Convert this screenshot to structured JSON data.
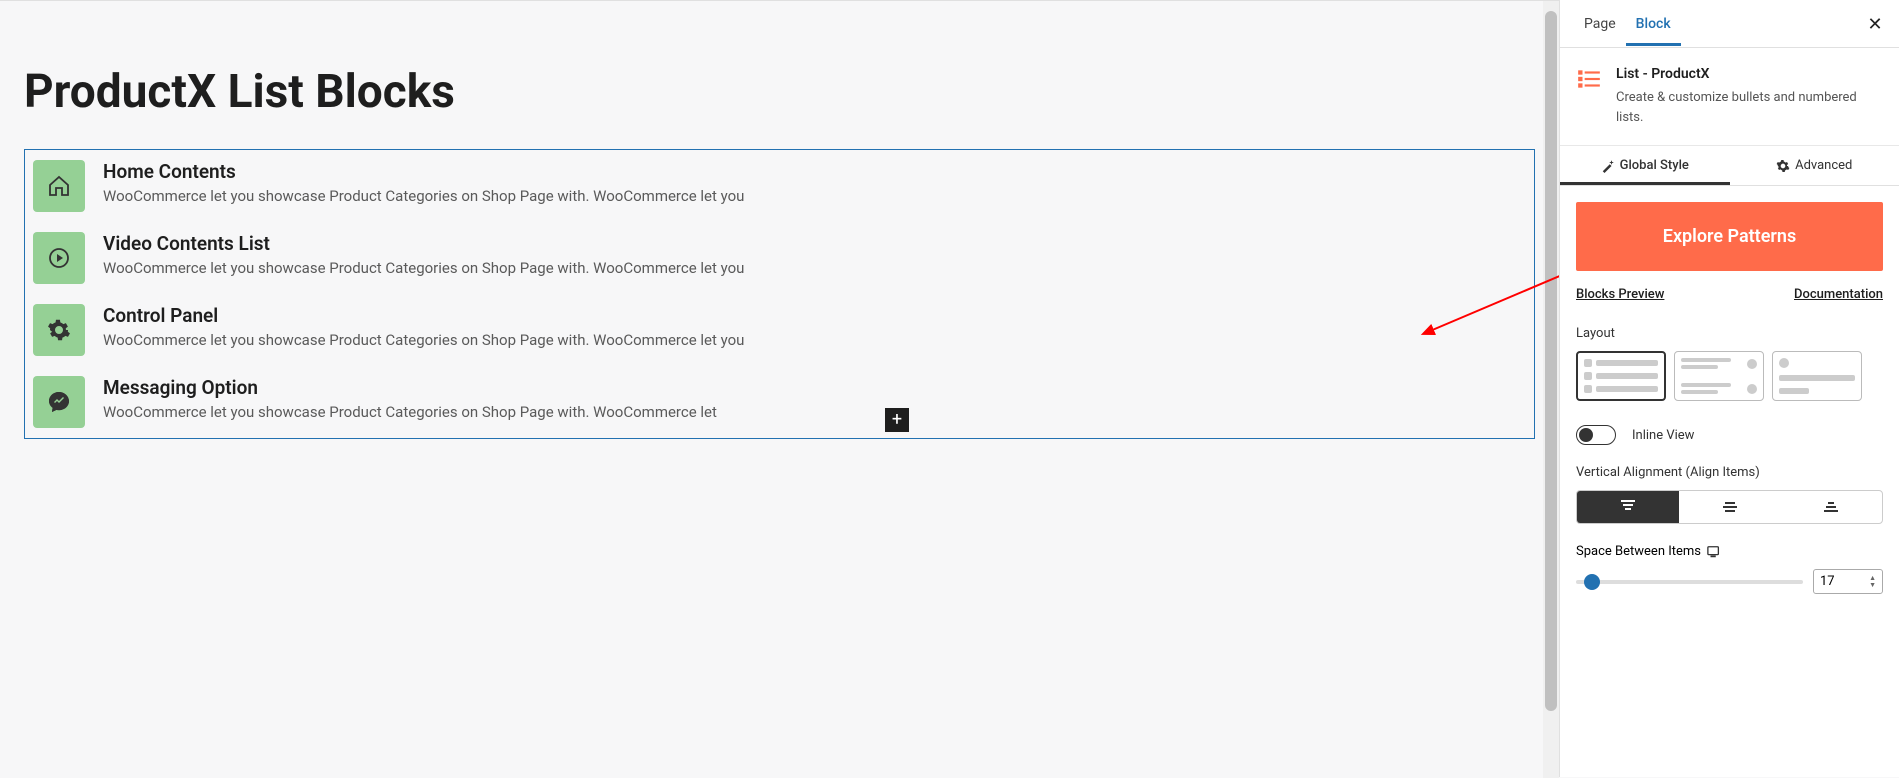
{
  "editor": {
    "page_title": "ProductX List Blocks",
    "list_items": [
      {
        "title": "Home Contents",
        "desc": "WooCommerce let you showcase Product Categories on Shop Page with. WooCommerce let you",
        "icon": "home-icon"
      },
      {
        "title": "Video Contents List",
        "desc": "WooCommerce let you showcase Product Categories on Shop Page with. WooCommerce let you",
        "icon": "play-icon"
      },
      {
        "title": "Control Panel",
        "desc": "WooCommerce let you showcase Product Categories on Shop Page with. WooCommerce let you",
        "icon": "gear-icon"
      },
      {
        "title": "Messaging Option",
        "desc": "WooCommerce let you showcase Product Categories on Shop Page with. WooCommerce let",
        "icon": "message-icon"
      }
    ]
  },
  "sidebar": {
    "tabs": {
      "page": "Page",
      "block": "Block"
    },
    "block": {
      "name": "List - ProductX",
      "desc": "Create & customize bullets and numbered lists."
    },
    "settings_tabs": {
      "global": "Global Style",
      "advanced": "Advanced"
    },
    "explore": "Explore Patterns",
    "links": {
      "preview": "Blocks Preview",
      "docs": "Documentation"
    },
    "layout_label": "Layout",
    "inline_label": "Inline View",
    "valign_label": "Vertical Alignment (Align Items)",
    "space_label": "Space Between Items",
    "space_value": "17"
  }
}
